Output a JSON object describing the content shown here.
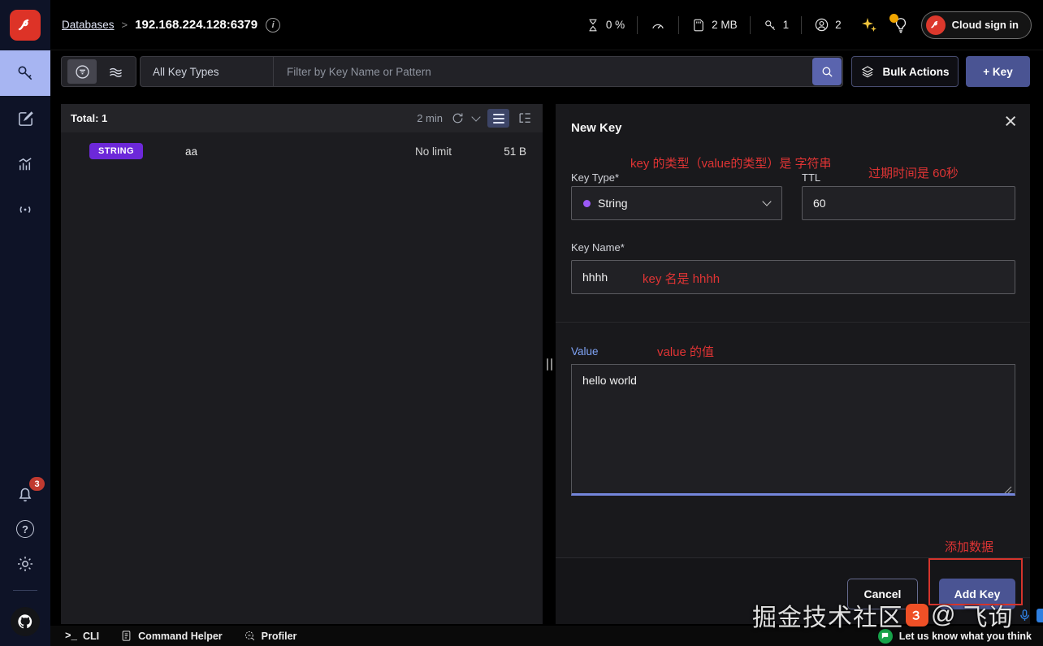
{
  "topbar": {
    "breadcrumb_link": "Databases",
    "breadcrumb_separator": ">",
    "instance": "192.168.224.128:6379",
    "info_glyph": "i",
    "metrics": {
      "cpu": "0 %",
      "memory": "2 MB",
      "keys": "1",
      "clients": "2"
    },
    "cloud_signin_label": "Cloud sign in"
  },
  "filterbar": {
    "key_type_filter": "All Key Types",
    "search_placeholder": "Filter by Key Name or Pattern",
    "bulk_actions_label": "Bulk Actions",
    "add_key_label": "+ Key"
  },
  "key_list": {
    "total_label": "Total: 1",
    "refresh_interval": "2 min",
    "rows": [
      {
        "type": "STRING",
        "name": "aa",
        "ttl": "No limit",
        "size": "51 B"
      }
    ]
  },
  "new_key_dialog": {
    "title": "New Key",
    "close_glyph": "×",
    "key_type_label": "Key Type*",
    "key_type_value": "String",
    "ttl_label": "TTL",
    "ttl_value": "60",
    "key_name_label": "Key Name*",
    "key_name_value": "hhhh",
    "value_label": "Value",
    "value_text": "hello world",
    "cancel_label": "Cancel",
    "add_key_label": "Add Key"
  },
  "sidebar": {
    "notifications_badge": "3",
    "help_glyph": "?"
  },
  "bottom_bar": {
    "cli_prompt": ">_",
    "cli_label": "CLI",
    "command_helper_label": "Command Helper",
    "profiler_label": "Profiler",
    "feedback_label": "Let us know what you think"
  },
  "annotations": {
    "key_type_note": "key 的类型（value的类型）是 字符串",
    "ttl_note": "过期时间是 60秒",
    "key_name_note": "key 名是 hhhh",
    "value_note": "value 的值",
    "add_note": "添加数据"
  },
  "watermark": {
    "community": "掘金技术社区",
    "at": "@",
    "author": "飞询"
  },
  "colors": {
    "accent_indigo": "#4a5493",
    "sidebar_active": "#a7b5f2",
    "string_badge": "#6d28d9",
    "annotation_red": "#df3434",
    "redis_red": "#dc382c",
    "value_label_blue": "#7fa3f5"
  }
}
